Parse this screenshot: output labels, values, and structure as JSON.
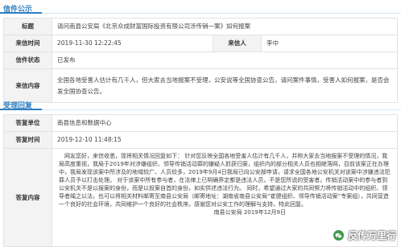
{
  "letter": {
    "section_title": "信件公示",
    "title_label": "标题",
    "title_value": "请问南县公安局《北京众成财富国际投资有限公司涉传销一案》如何报案",
    "time_label": "来信时间",
    "time_value": "2019-11-30 12:22:45",
    "sender_label": "来信人",
    "sender_value": "李中",
    "status_label": "信件状态",
    "status_value": "已发布",
    "content_label": "来信内容",
    "content_value": "全国各地受害人估计有几千人，但大家去当地报案不受理，公安说等全国协查公告，请问案件事情，受害人如何报案，是否会发全国协查公告。"
  },
  "reply": {
    "section_title": "受理回复",
    "unit_label": "答复单位",
    "unit_value": "南县信息和数据中心",
    "time_label": "答复时间",
    "time_value": "2019-12-10 11:48:15",
    "content_label": "答复内容",
    "paragraphs": [
      "网友您好，来信收悉，现将相关情况回复如下：    针对您反映全国各地受害人估计有几千人，并称大家去当地报案不受理的情况，我局高度重视，我局于2019年对涉嫌组织、领导传销活动罪的嫌疑人抓获归案，组织内的部分相关人员也相继落网，目前该案正在办理中，我局发现该案中所涉及的地域较广、人员较多，2019年9月4日我局已向公安部申请，请求全国各地公安机关对该案中涉嫌违法犯罪人员予以打击处理。    对于该案中所有参与者，在法律上已明确界定都是违法人员，不是您所说的受害者。传销活动案中的参与者到公安机关不是以报案的身份，而是以投案自首的身份，如实供述违法行为。    同时，希望通过大家的共同努力将传销活动中的组织、领导者绳之以法，也可以将相关材料邮寄至南县公安局（邮寄地址：湖南省南县公安局“崔健组织、领导传销活动案”专案组），共同营造一个良好的社会环境，共同维护一个良好的社会秩序。感谢您对公安工作的理解与支持，特此回复。"
    ],
    "sign_date": "南县公安局    2019年12月9日"
  },
  "watermark": {
    "text": "反传万里行",
    "icon": "wechat-icon"
  }
}
